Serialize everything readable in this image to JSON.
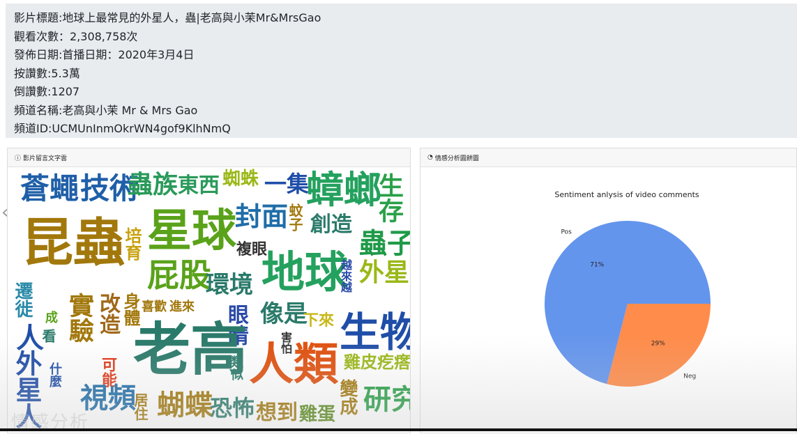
{
  "video_info": {
    "title": "影片標題:地球上最常見的外星人，蟲|老高與小茉Mr&MrsGao",
    "views": "觀看次數：2,308,758次",
    "publish_date": "發佈日期:首播日期：2020年3月4日",
    "likes": "按讚數:5.3萬",
    "dislikes": "倒讚數:1207",
    "channel_name": "頻道名稱:老高與小茉 Mr & Mrs Gao",
    "channel_id": "頻道ID:UCMUnInmOkrWN4gof9KlhNmQ"
  },
  "wordcloud_panel": {
    "icon": "info-circle-icon",
    "title": "影片留言文字雲",
    "words": [
      "蒼蠅",
      "技術",
      "蟲族",
      "東西",
      "蜘蛛",
      "一集",
      "蟑螂",
      "生存",
      "昆蟲",
      "星球",
      "封面",
      "蚊子",
      "創造",
      "培育",
      "複眼",
      "蟲子",
      "屁股",
      "環境",
      "地球",
      "外星",
      "遷徙",
      "越來越",
      "喜歡",
      "進來",
      "像是",
      "下來",
      "實驗",
      "改造",
      "身體",
      "眼睛",
      "生物",
      "人",
      "看",
      "成",
      "老高",
      "害怕",
      "人類",
      "雞皮疙瘩",
      "外星人",
      "什麼",
      "可能",
      "類似",
      "視頻",
      "居住",
      "蝴蝶",
      "恐怖",
      "想到",
      "雞蛋",
      "變成",
      "研究"
    ]
  },
  "nav": {
    "prev_icon": "chevron-left-icon",
    "prev_glyph": "‹"
  },
  "overlay_text": "情感分析",
  "sentiment_panel": {
    "icon": "pie-chart-icon",
    "title": "情感分析圓餅圖"
  },
  "colors": {
    "pos": "#6495ed",
    "neg": "#ff8c4a"
  },
  "chart_data": {
    "type": "pie",
    "title": "Sentiment anlysis of video comments",
    "labels": [
      "Pos",
      "Neg"
    ],
    "values": [
      71,
      29
    ],
    "value_labels": [
      "71%",
      "29%"
    ]
  }
}
